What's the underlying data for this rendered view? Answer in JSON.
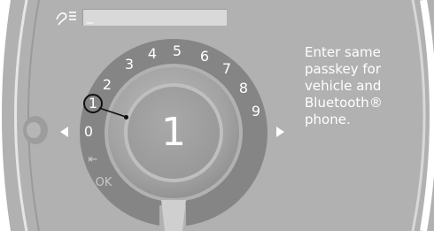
{
  "screen": {
    "input_value": "_",
    "instruction_lines": [
      "Enter same",
      "passkey for",
      "vehicle and",
      "Bluetooth®",
      "phone."
    ],
    "selected_digit": "1",
    "speller_digits": [
      "1",
      "2",
      "3",
      "4",
      "5",
      "6",
      "7",
      "8",
      "9",
      "0"
    ],
    "delete_symbol": "⇤",
    "ok_label": "OK",
    "icons": {
      "voice": "voice-command-icon",
      "left": "left-arrow-icon",
      "right": "right-arrow-icon"
    }
  },
  "colors": {
    "background": "#b1b1b1",
    "dial_ring": "#848484",
    "center_knob": "#a5a5a5",
    "text": "#ffffff",
    "input_field": "#d9d9d9",
    "callout": "#111111"
  }
}
